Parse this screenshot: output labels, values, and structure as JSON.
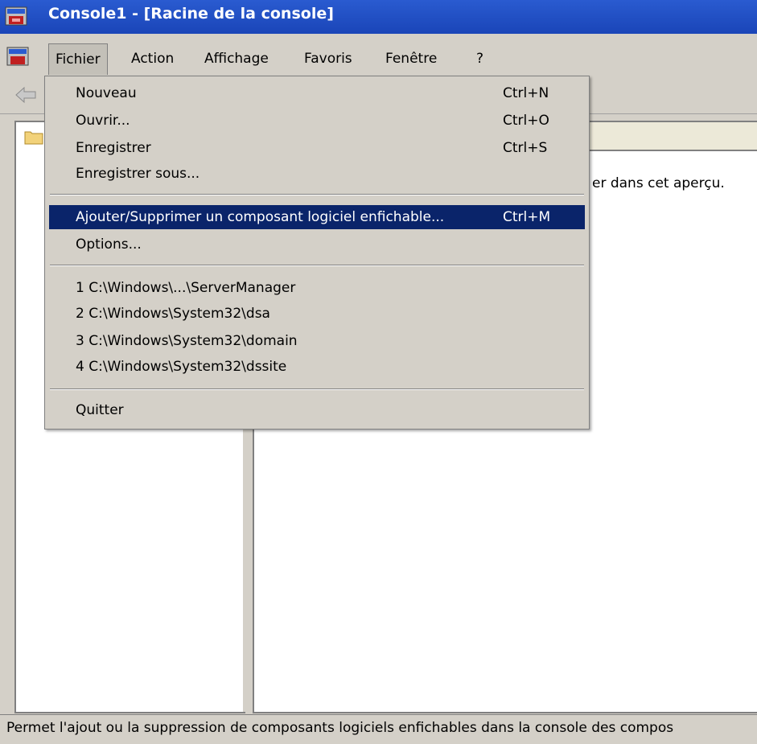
{
  "window": {
    "title": "Console1 - [Racine de la console]"
  },
  "menubar": {
    "items": [
      {
        "label": "Fichier"
      },
      {
        "label": "Action"
      },
      {
        "label": "Affichage"
      },
      {
        "label": "Favoris"
      },
      {
        "label": "Fenêtre"
      },
      {
        "label": "?"
      }
    ]
  },
  "file_menu": {
    "items": [
      {
        "label": "Nouveau",
        "shortcut": "Ctrl+N"
      },
      {
        "label": "Ouvrir...",
        "shortcut": "Ctrl+O"
      },
      {
        "label": "Enregistrer",
        "shortcut": "Ctrl+S"
      },
      {
        "label": "Enregistrer sous...",
        "shortcut": ""
      },
      {
        "label": "Ajouter/Supprimer un composant logiciel enfichable...",
        "shortcut": "Ctrl+M"
      },
      {
        "label": "Options...",
        "shortcut": ""
      },
      {
        "label": "1 C:\\Windows\\...\\ServerManager",
        "shortcut": ""
      },
      {
        "label": "2 C:\\Windows\\System32\\dsa",
        "shortcut": ""
      },
      {
        "label": "3 C:\\Windows\\System32\\domain",
        "shortcut": ""
      },
      {
        "label": "4 C:\\Windows\\System32\\dssite",
        "shortcut": ""
      },
      {
        "label": "Quitter",
        "shortcut": ""
      }
    ]
  },
  "right_pane": {
    "message": "er dans cet aperçu."
  },
  "status_bar": {
    "text": "Permet l'ajout ou la suppression de composants logiciels enfichables dans la console des compos"
  },
  "colors": {
    "highlight": "#0a246a",
    "titlebar": "#1a45b8",
    "chrome": "#d4d0c8"
  },
  "icons": [
    "console-app-icon",
    "back-arrow-icon",
    "folder-icon"
  ]
}
